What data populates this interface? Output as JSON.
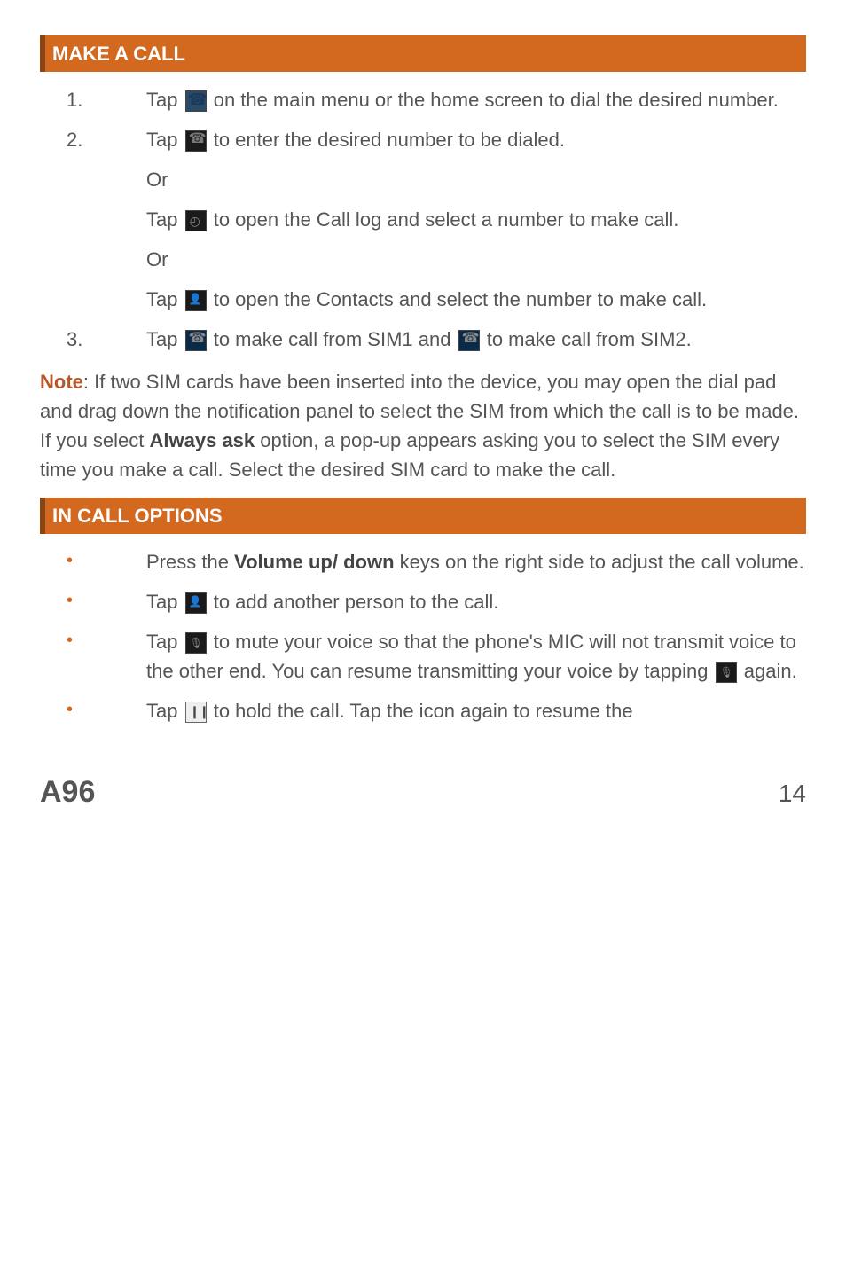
{
  "header1": "MAKE A CALL",
  "step1_a": "Tap ",
  "step1_b": " on the main menu or the home screen to dial the desired number.",
  "step2_a": "Tap ",
  "step2_b": " to enter the desired number to be dialed.",
  "or": "Or",
  "step2_c": "Tap ",
  "step2_d": " to open the Call log and select a number to make call.",
  "step2_e": "Tap ",
  "step2_f": " to open the Contacts and select the number to make call.",
  "step3_a": "Tap ",
  "step3_b": " to make call from SIM1 and ",
  "step3_c": " to make call from SIM2.",
  "note_label": "Note",
  "note_a": ": If two SIM cards have been inserted into the device, you may open the dial pad and drag down the notification panel to select the SIM from which the call is to be made. If you select ",
  "note_bold": "Always ask",
  "note_b": " option, a pop-up appears asking you to select the SIM every time you make a call. Select the desired SIM card to make the call.",
  "header2": "IN CALL OPTIONS",
  "b1_a": "Press the ",
  "b1_bold": "Volume up/ down",
  "b1_b": " keys on the right side to adjust the call volume.",
  "b2_a": "Tap ",
  "b2_b": " to add another person to the call.",
  "b3_a": "Tap ",
  "b3_b": " to mute your voice so that the phone's MIC will not transmit voice to the other end. You can resume transmitting your voice by tapping ",
  "b3_c": " again.",
  "b4_a": "Tap ",
  "b4_b": " to hold the call. Tap the icon again to resume the",
  "num1": "1.",
  "num2": "2.",
  "num3": "3.",
  "bullet": "•",
  "footer_model": "A96",
  "footer_page": "14"
}
